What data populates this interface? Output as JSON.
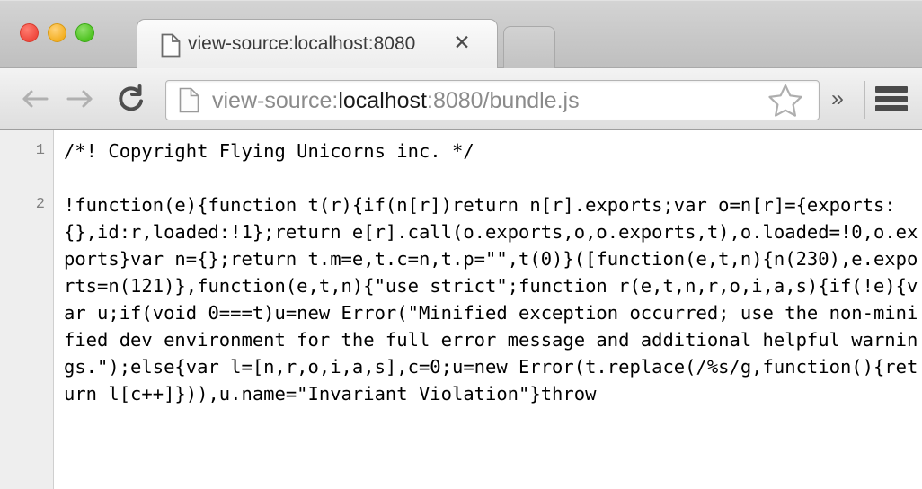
{
  "window": {
    "traffic_lights": [
      {
        "name": "close",
        "color": "#f04a3f"
      },
      {
        "name": "minimize",
        "color": "#f4b024"
      },
      {
        "name": "maximize",
        "color": "#4fc321"
      }
    ]
  },
  "tabstrip": {
    "tab": {
      "title": "view-source:localhost:8080",
      "favicon": "document-icon",
      "close_label": "✕"
    },
    "new_tab_label": ""
  },
  "toolbar": {
    "back_label": "←",
    "forward_label": "→",
    "reload_label": "⟳",
    "url": {
      "prefix": "view-source:",
      "host": "localhost",
      "suffix": ":8080/bundle.js",
      "full": "view-source:localhost:8080/bundle.js",
      "favicon": "document-icon"
    },
    "bookmark_label": "star-icon",
    "overflow_label": "»",
    "menu_label": "hamburger-icon"
  },
  "source_view": {
    "lines": [
      {
        "number": "1",
        "text": "/*! Copyright Flying Unicorns inc. */",
        "rows": 1
      },
      {
        "number": "2",
        "text": "!function(e){function t(r){if(n[r])return n[r].exports;var o=n[r]={exports:{},id:r,loaded:!1};return e[r].call(o.exports,o,o.exports,t),o.loaded=!0,o.exports}var n={};return t.m=e,t.c=n,t.p=\"\",t(0)}([function(e,t,n){n(230),e.exports=n(121)},function(e,t,n){\"use strict\";function r(e,t,n,r,o,i,a,s){if(!e){var u;if(void 0===t)u=new Error(\"Minified exception occurred; use the non-minified dev environment for the full error message and additional helpful warnings.\");else{var l=[n,r,o,i,a,s],c=0;u=new Error(t.replace(/%s/g,function(){return l[c++]})),u.name=\"Invariant Violation\"}throw",
        "rows": 12
      }
    ]
  }
}
